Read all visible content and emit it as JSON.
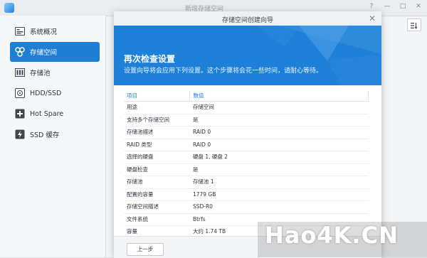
{
  "window": {
    "title": "新增存储空间",
    "controls": [
      "?",
      "—",
      "□",
      "✕"
    ]
  },
  "sidebar": {
    "items": [
      {
        "label": "系统概况",
        "icon": "overview-icon"
      },
      {
        "label": "存储空间",
        "icon": "storage-space-icon",
        "active": true
      },
      {
        "label": "存储池",
        "icon": "storage-pool-icon"
      },
      {
        "label": "HDD/SSD",
        "icon": "disk-icon"
      },
      {
        "label": "Hot Spare",
        "icon": "plus-icon"
      },
      {
        "label": "SSD 缓存",
        "icon": "lightning-icon"
      }
    ]
  },
  "dialog": {
    "title": "存储空间创建向导",
    "close": "✕",
    "banner_title": "再次检查设置",
    "banner_desc": "设置向导将会应用下列设置。这个步骤将会花一些时间，请耐心等待。",
    "table": {
      "headers": [
        "项目",
        "数值"
      ],
      "rows": [
        [
          "用途",
          "存储空间"
        ],
        [
          "支持多个存储空间",
          "是"
        ],
        [
          "存储池描述",
          "RAID 0"
        ],
        [
          "RAID 类型",
          "RAID 0"
        ],
        [
          "选择的硬盘",
          "硬盘 1, 硬盘 2"
        ],
        [
          "硬盘检查",
          "是"
        ],
        [
          "存储池",
          "存储池 1"
        ],
        [
          "配置的容量",
          "1779 GB"
        ],
        [
          "存储空间描述",
          "SSD-R0"
        ],
        [
          "文件系统",
          "Btrfs"
        ],
        [
          "容量",
          "大约 1.74 TB"
        ]
      ]
    },
    "prev_button": "上一步"
  },
  "watermark": "Hao4K.CN",
  "colors": {
    "accent": "#1f7fd5",
    "banner": "#1e80d8"
  }
}
